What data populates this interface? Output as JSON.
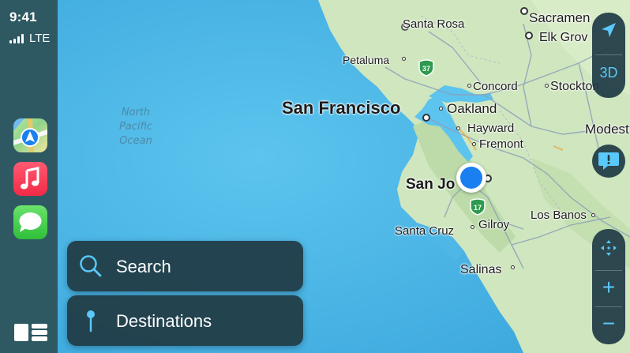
{
  "status": {
    "time": "9:41",
    "network": "LTE"
  },
  "apps": [
    {
      "name": "Maps",
      "icon": "maps-app-icon"
    },
    {
      "name": "Music",
      "icon": "music-app-icon"
    },
    {
      "name": "Messages",
      "icon": "messages-app-icon"
    }
  ],
  "map": {
    "ocean_label": [
      "North",
      "Pacific",
      "Ocean"
    ],
    "cities": {
      "sacramento": "Sacramen",
      "santa_rosa": "Santa Rosa",
      "elk_grove": "Elk Grov",
      "petaluma": "Petaluma",
      "concord": "Concord",
      "stockton": "Stockton",
      "san_francisco": "San Francisco",
      "oakland": "Oakland",
      "hayward": "Hayward",
      "modesto": "Modest",
      "fremont": "Fremont",
      "san_jose": "San Jo",
      "los_banos": "Los Banos",
      "santa_cruz": "Santa Cruz",
      "gilroy": "Gilroy",
      "salinas": "Salinas"
    },
    "route_shields": [
      "37",
      "17"
    ]
  },
  "panels": {
    "search": "Search",
    "destinations": "Destinations"
  },
  "controls": {
    "three_d": "3D",
    "zoom_in": "+",
    "zoom_out": "−"
  },
  "colors": {
    "sidebar": "#2f5962",
    "ocean": "#48b4e6",
    "land": "#cfe6bf",
    "accent": "#5ac8fa",
    "location": "#1a7ff0"
  }
}
